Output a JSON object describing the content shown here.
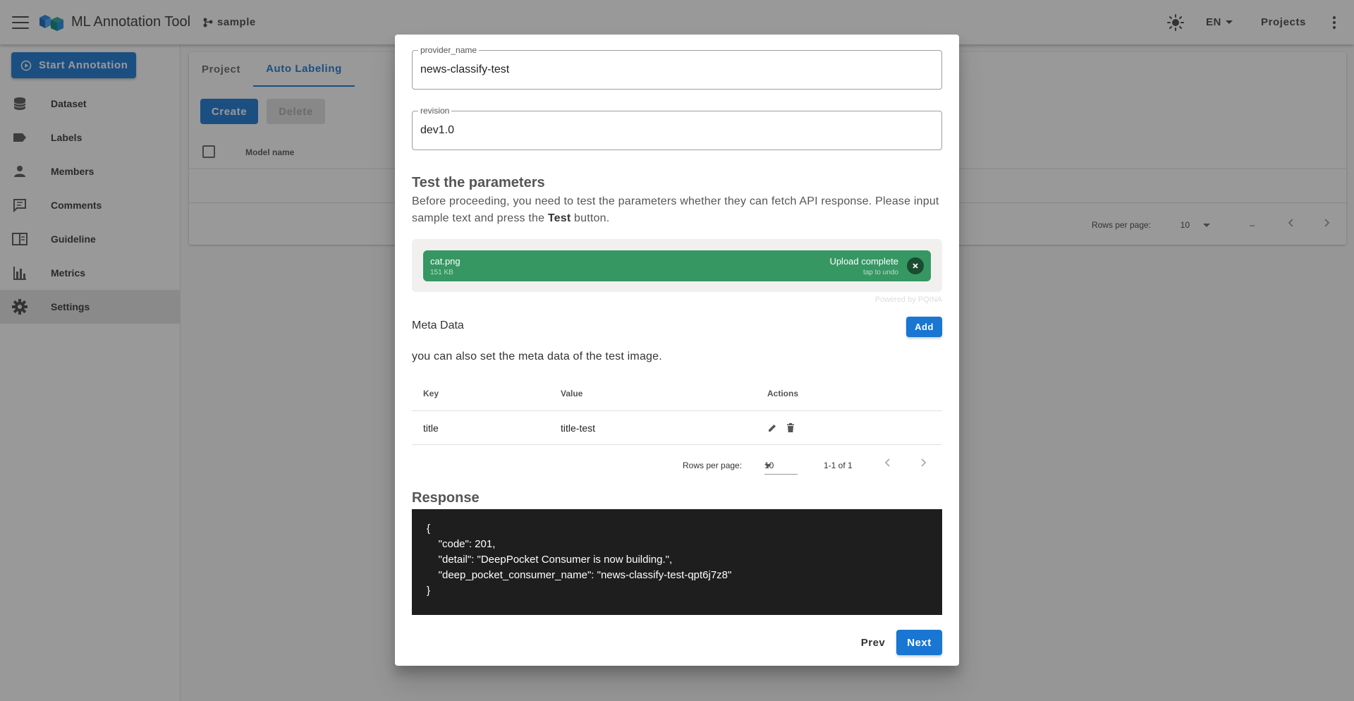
{
  "appbar": {
    "title": "ML Annotation Tool",
    "project_name": "sample",
    "language": "EN",
    "projects_label": "Projects",
    "icons": [
      "menu-icon",
      "logo-icon",
      "branch-icon",
      "sun-icon",
      "chevron-down-icon",
      "more-vertical-icon"
    ]
  },
  "sidebar": {
    "start_label": "Start Annotation",
    "items": [
      {
        "label": "Dataset",
        "icon": "database-icon"
      },
      {
        "label": "Labels",
        "icon": "label-icon"
      },
      {
        "label": "Members",
        "icon": "person-icon"
      },
      {
        "label": "Comments",
        "icon": "comment-icon"
      },
      {
        "label": "Guideline",
        "icon": "book-icon"
      },
      {
        "label": "Metrics",
        "icon": "bar-chart-icon"
      },
      {
        "label": "Settings",
        "icon": "gear-icon",
        "active": true
      }
    ]
  },
  "main": {
    "tabs": [
      {
        "label": "Project"
      },
      {
        "label": "Auto Labeling",
        "active": true
      }
    ],
    "create_label": "Create",
    "delete_label": "Delete",
    "table_header": "Model name",
    "rows_per_page_label": "Rows per page:",
    "rows_per_page_value": "10",
    "range_text": "–"
  },
  "dialog": {
    "fields": {
      "provider_name": {
        "label": "provider_name",
        "value": "news-classify-test"
      },
      "revision": {
        "label": "revision",
        "value": "dev1.0"
      }
    },
    "test_title": "Test the parameters",
    "test_desc_before": "Before proceeding, you need to test the parameters whether they can fetch API response. Please input sample text and press the ",
    "test_desc_bold": "Test",
    "test_desc_after": " button.",
    "upload": {
      "file_name": "cat.png",
      "file_size": "151 KB",
      "status": "Upload complete",
      "status_sub": "tap to undo",
      "powered_by": "Powered by PQINA"
    },
    "meta_title": "Meta Data",
    "add_label": "Add",
    "meta_desc": "you can also set the meta data of the test image.",
    "meta_table": {
      "headers": [
        "Key",
        "Value",
        "Actions"
      ],
      "rows": [
        {
          "key": "title",
          "value": "title-test"
        }
      ],
      "rows_per_page_label": "Rows per page:",
      "rows_per_page_value": "10",
      "range_text": "1-1 of 1"
    },
    "response_title": "Response",
    "response_body": "{\n    \"code\": 201,\n    \"detail\": \"DeepPocket Consumer is now building.\",\n    \"deep_pocket_consumer_name\": \"news-classify-test-qpt6j7z8\"\n}",
    "prev_label": "Prev",
    "next_label": "Next"
  },
  "colors": {
    "primary": "#1976d2",
    "upload_success": "#369763",
    "code_background": "#1e1e1e",
    "overlay": "rgba(33,33,33,0.46)"
  }
}
